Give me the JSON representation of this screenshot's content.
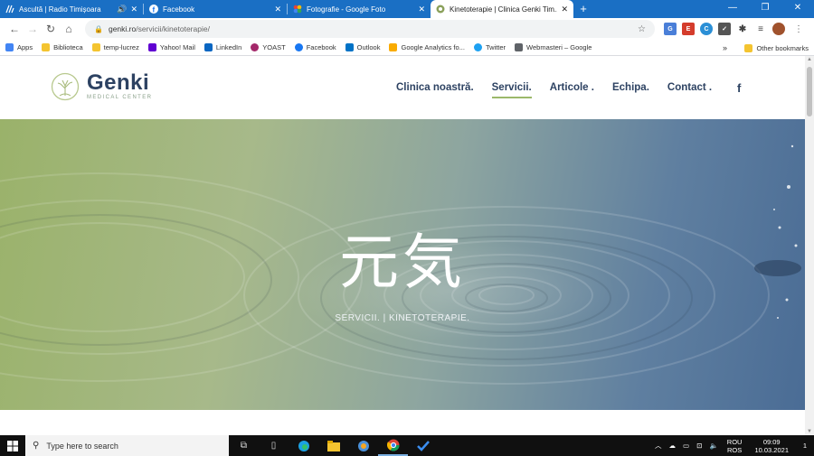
{
  "browser": {
    "tabs": [
      {
        "title": "Ascultă | Radio Timișoara",
        "icon": "radio-icon",
        "audio": "🔊",
        "close": "✕",
        "active": false
      },
      {
        "title": "Facebook",
        "icon": "facebook-icon",
        "close": "✕",
        "active": false
      },
      {
        "title": "Fotografie - Google Foto",
        "icon": "google-photos-icon",
        "close": "✕",
        "active": false
      },
      {
        "title": "Kinetoterapie | Clinica Genki Tim...",
        "icon": "genki-favicon-icon",
        "close": "✕",
        "active": true
      }
    ],
    "new_tab": "+",
    "window_controls": {
      "minimize": "—",
      "maximize": "❐",
      "close": "✕"
    },
    "address": {
      "domain": "genki.ro",
      "path": "/servicii/kinetoterapie/"
    },
    "bookmarks": [
      {
        "label": "Apps",
        "color": "#4285f4"
      },
      {
        "label": "Biblioteca",
        "color": "#f4c430"
      },
      {
        "label": "temp-lucrez",
        "color": "#f4c430"
      },
      {
        "label": "Yahoo! Mail",
        "color": "#6001d2"
      },
      {
        "label": "LinkedIn",
        "color": "#0a66c2"
      },
      {
        "label": "YOAST",
        "color": "#a4286a"
      },
      {
        "label": "Facebook",
        "color": "#1877f2"
      },
      {
        "label": "Outlook",
        "color": "#0072c6"
      },
      {
        "label": "Google Analytics fo...",
        "color": "#f9ab00"
      },
      {
        "label": "Twitter",
        "color": "#1da1f2"
      },
      {
        "label": "Webmasteri – Google",
        "color": "#5f6368"
      }
    ],
    "bookmarks_more": "»",
    "other_bookmarks": "Other bookmarks"
  },
  "site": {
    "logo": {
      "name": "Genki",
      "subtitle": "MEDICAL CENTER"
    },
    "menu": [
      {
        "label": "Clinica noastră.",
        "active": false
      },
      {
        "label": "Servicii.",
        "active": true
      },
      {
        "label": "Articole .",
        "active": false
      },
      {
        "label": "Echipa.",
        "active": false
      },
      {
        "label": "Contact .",
        "active": false
      }
    ],
    "social_icon": "f",
    "hero": {
      "kanji": "元気",
      "breadcrumb": "SERVICII.  |  KINETOTERAPIE."
    }
  },
  "taskbar": {
    "search_placeholder": "Type here to search",
    "lang_top": "ROU",
    "lang_bottom": "ROS",
    "time": "09:09",
    "date": "10.03.2021",
    "notifications": "1"
  },
  "colors": {
    "brand": "#2d4262",
    "accent": "#9bb86a",
    "chrome_blue": "#1a6fc4"
  }
}
